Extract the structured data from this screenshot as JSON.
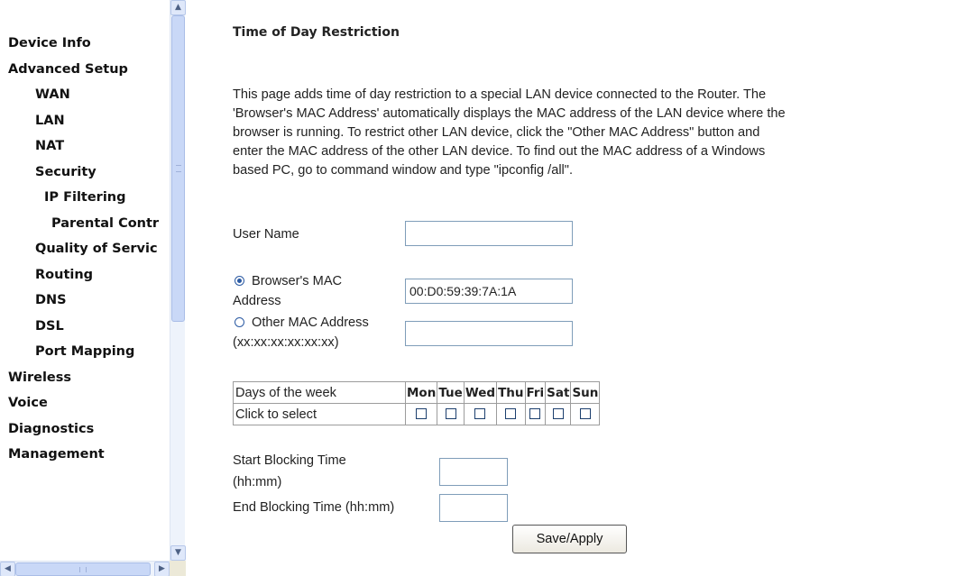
{
  "sidebar": {
    "items": [
      {
        "label": "Device Info"
      },
      {
        "label": "Advanced Setup"
      },
      {
        "label": "WAN"
      },
      {
        "label": "LAN"
      },
      {
        "label": "NAT"
      },
      {
        "label": "Security"
      },
      {
        "label": "IP Filtering"
      },
      {
        "label": "Parental Contr"
      },
      {
        "label": "Quality of Servic"
      },
      {
        "label": "Routing"
      },
      {
        "label": "DNS"
      },
      {
        "label": "DSL"
      },
      {
        "label": "Port Mapping"
      },
      {
        "label": "Wireless"
      },
      {
        "label": "Voice"
      },
      {
        "label": "Diagnostics"
      },
      {
        "label": "Management"
      }
    ]
  },
  "page": {
    "title": "Time of Day Restriction",
    "intro_lines": [
      "This page adds time of day restriction to a special LAN device connected to the Router. The",
      "'Browser's MAC Address' automatically displays the MAC address of the LAN device where the",
      "browser is running. To restrict other LAN device, click the \"Other MAC Address\" button and",
      "enter the MAC address of the other LAN device. To find out the MAC address of a Windows",
      "based PC, go to command window and type \"ipconfig /all\"."
    ]
  },
  "form": {
    "user_name_label": "User Name",
    "user_name_value": "",
    "browser_mac_label_1": "Browser's MAC",
    "browser_mac_label_2": "Address",
    "browser_mac_value": "00:D0:59:39:7A:1A",
    "browser_mac_selected": true,
    "other_mac_label_1": "Other MAC Address",
    "other_mac_label_2": "(xx:xx:xx:xx:xx:xx)",
    "other_mac_value": "",
    "days_header": "Days of the week",
    "click_to_select": "Click to select",
    "days": [
      "Mon",
      "Tue",
      "Wed",
      "Thu",
      "Fri",
      "Sat",
      "Sun"
    ],
    "start_label_1": "Start Blocking Time",
    "start_label_2": "(hh:mm)",
    "end_label": "End Blocking Time (hh:mm)",
    "save_label": "Save/Apply"
  },
  "colors": {
    "scrollbar_thumb": "#c9d8f7",
    "input_border": "#7f9db9"
  }
}
